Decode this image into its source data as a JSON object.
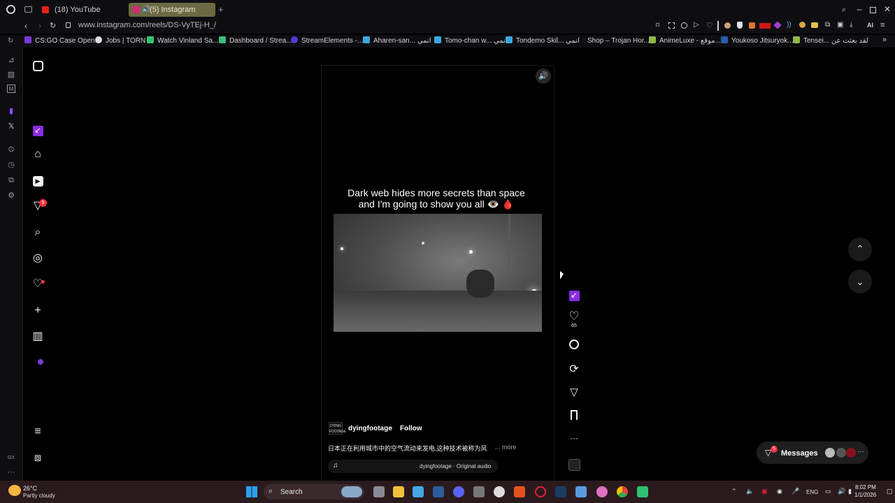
{
  "tabs": [
    {
      "label": "(18) YouTube",
      "color": "#e62117"
    },
    {
      "label": "(5) Instagram",
      "color": "#d62976"
    }
  ],
  "address": {
    "url": "www.instagram.com/reels/DS-VyTEj-H_/"
  },
  "toolbar_right": {
    "ai_label": "AI"
  },
  "bookmarks": [
    "CS:GO Case Open...",
    "Jobs | TORN",
    "Watch Vinland Sa...",
    "Dashboard / Strea...",
    "StreamElements -...",
    "Aharen-san... انمي",
    "Tomo-chan w... انمي",
    "Tondemo Skil... انمي",
    "Shop – Trojan Hor...",
    "AnimeLuxe - موقع...",
    "Youkoso Jitsuryok...",
    "Tensei... لقد بعثت عن"
  ],
  "nav": {
    "notifications_badge": "5"
  },
  "reel": {
    "overlay_text_1": "Dark web hides more secrets than space",
    "overlay_text_2": "and I'm going to show you all 👁️ 🩸",
    "username": "dyingfootage",
    "follow_label": "Follow",
    "separator": "•",
    "caption": "日本正在利用城市中的空气流动来发电,这种技术被称为风",
    "more_label": "... more",
    "audio": "dyingfootage · Original audio",
    "like_count": "65",
    "avatar_text": "DYING FOOTAGE"
  },
  "messages": {
    "label": "Messages",
    "badge": "5"
  },
  "sidebar_bottom": {
    "gx_label": "GX"
  },
  "taskbar": {
    "weather_temp": "26°C",
    "weather_desc": "Partly cloudy",
    "search_label": "Search",
    "lang": "ENG",
    "time": "8:02 PM",
    "date": "1/1/2026"
  },
  "colors": {
    "accent_purple": "#8a2be2",
    "notify_red": "#ff3040"
  }
}
